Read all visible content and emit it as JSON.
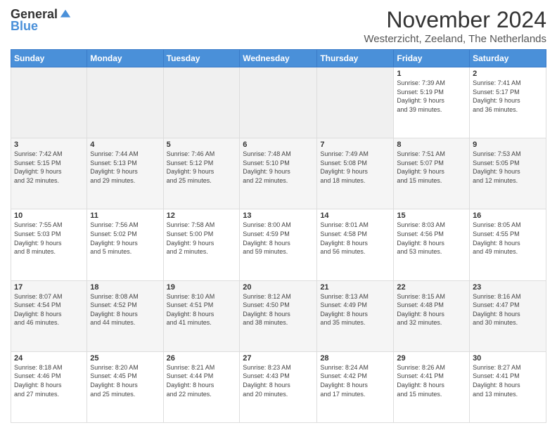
{
  "header": {
    "logo_general": "General",
    "logo_blue": "Blue",
    "title": "November 2024",
    "location": "Westerzicht, Zeeland, The Netherlands"
  },
  "columns": [
    "Sunday",
    "Monday",
    "Tuesday",
    "Wednesday",
    "Thursday",
    "Friday",
    "Saturday"
  ],
  "weeks": [
    {
      "days": [
        {
          "num": "",
          "info": ""
        },
        {
          "num": "",
          "info": ""
        },
        {
          "num": "",
          "info": ""
        },
        {
          "num": "",
          "info": ""
        },
        {
          "num": "",
          "info": ""
        },
        {
          "num": "1",
          "info": "Sunrise: 7:39 AM\nSunset: 5:19 PM\nDaylight: 9 hours\nand 39 minutes."
        },
        {
          "num": "2",
          "info": "Sunrise: 7:41 AM\nSunset: 5:17 PM\nDaylight: 9 hours\nand 36 minutes."
        }
      ]
    },
    {
      "days": [
        {
          "num": "3",
          "info": "Sunrise: 7:42 AM\nSunset: 5:15 PM\nDaylight: 9 hours\nand 32 minutes."
        },
        {
          "num": "4",
          "info": "Sunrise: 7:44 AM\nSunset: 5:13 PM\nDaylight: 9 hours\nand 29 minutes."
        },
        {
          "num": "5",
          "info": "Sunrise: 7:46 AM\nSunset: 5:12 PM\nDaylight: 9 hours\nand 25 minutes."
        },
        {
          "num": "6",
          "info": "Sunrise: 7:48 AM\nSunset: 5:10 PM\nDaylight: 9 hours\nand 22 minutes."
        },
        {
          "num": "7",
          "info": "Sunrise: 7:49 AM\nSunset: 5:08 PM\nDaylight: 9 hours\nand 18 minutes."
        },
        {
          "num": "8",
          "info": "Sunrise: 7:51 AM\nSunset: 5:07 PM\nDaylight: 9 hours\nand 15 minutes."
        },
        {
          "num": "9",
          "info": "Sunrise: 7:53 AM\nSunset: 5:05 PM\nDaylight: 9 hours\nand 12 minutes."
        }
      ]
    },
    {
      "days": [
        {
          "num": "10",
          "info": "Sunrise: 7:55 AM\nSunset: 5:03 PM\nDaylight: 9 hours\nand 8 minutes."
        },
        {
          "num": "11",
          "info": "Sunrise: 7:56 AM\nSunset: 5:02 PM\nDaylight: 9 hours\nand 5 minutes."
        },
        {
          "num": "12",
          "info": "Sunrise: 7:58 AM\nSunset: 5:00 PM\nDaylight: 9 hours\nand 2 minutes."
        },
        {
          "num": "13",
          "info": "Sunrise: 8:00 AM\nSunset: 4:59 PM\nDaylight: 8 hours\nand 59 minutes."
        },
        {
          "num": "14",
          "info": "Sunrise: 8:01 AM\nSunset: 4:58 PM\nDaylight: 8 hours\nand 56 minutes."
        },
        {
          "num": "15",
          "info": "Sunrise: 8:03 AM\nSunset: 4:56 PM\nDaylight: 8 hours\nand 53 minutes."
        },
        {
          "num": "16",
          "info": "Sunrise: 8:05 AM\nSunset: 4:55 PM\nDaylight: 8 hours\nand 49 minutes."
        }
      ]
    },
    {
      "days": [
        {
          "num": "17",
          "info": "Sunrise: 8:07 AM\nSunset: 4:54 PM\nDaylight: 8 hours\nand 46 minutes."
        },
        {
          "num": "18",
          "info": "Sunrise: 8:08 AM\nSunset: 4:52 PM\nDaylight: 8 hours\nand 44 minutes."
        },
        {
          "num": "19",
          "info": "Sunrise: 8:10 AM\nSunset: 4:51 PM\nDaylight: 8 hours\nand 41 minutes."
        },
        {
          "num": "20",
          "info": "Sunrise: 8:12 AM\nSunset: 4:50 PM\nDaylight: 8 hours\nand 38 minutes."
        },
        {
          "num": "21",
          "info": "Sunrise: 8:13 AM\nSunset: 4:49 PM\nDaylight: 8 hours\nand 35 minutes."
        },
        {
          "num": "22",
          "info": "Sunrise: 8:15 AM\nSunset: 4:48 PM\nDaylight: 8 hours\nand 32 minutes."
        },
        {
          "num": "23",
          "info": "Sunrise: 8:16 AM\nSunset: 4:47 PM\nDaylight: 8 hours\nand 30 minutes."
        }
      ]
    },
    {
      "days": [
        {
          "num": "24",
          "info": "Sunrise: 8:18 AM\nSunset: 4:46 PM\nDaylight: 8 hours\nand 27 minutes."
        },
        {
          "num": "25",
          "info": "Sunrise: 8:20 AM\nSunset: 4:45 PM\nDaylight: 8 hours\nand 25 minutes."
        },
        {
          "num": "26",
          "info": "Sunrise: 8:21 AM\nSunset: 4:44 PM\nDaylight: 8 hours\nand 22 minutes."
        },
        {
          "num": "27",
          "info": "Sunrise: 8:23 AM\nSunset: 4:43 PM\nDaylight: 8 hours\nand 20 minutes."
        },
        {
          "num": "28",
          "info": "Sunrise: 8:24 AM\nSunset: 4:42 PM\nDaylight: 8 hours\nand 17 minutes."
        },
        {
          "num": "29",
          "info": "Sunrise: 8:26 AM\nSunset: 4:41 PM\nDaylight: 8 hours\nand 15 minutes."
        },
        {
          "num": "30",
          "info": "Sunrise: 8:27 AM\nSunset: 4:41 PM\nDaylight: 8 hours\nand 13 minutes."
        }
      ]
    }
  ]
}
